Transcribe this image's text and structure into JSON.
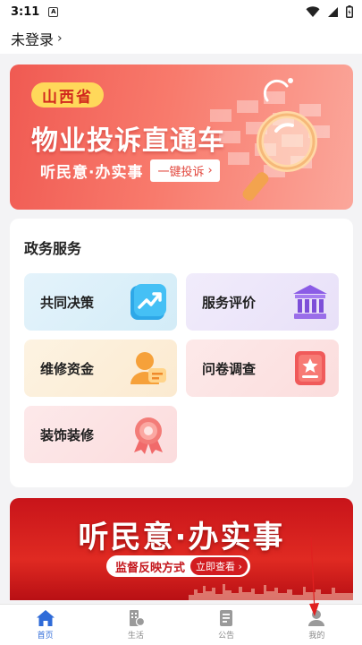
{
  "statusbar": {
    "time": "3:11",
    "notif_glyph": "A"
  },
  "header": {
    "login_text": "未登录",
    "chevron": "›"
  },
  "banner_complaint": {
    "province": "山西省",
    "title": "物业投诉直通车",
    "slogan": "听民意·办实事",
    "cta_label": "一键投诉",
    "cta_arrow": "›",
    "colors": {
      "start": "#f05a52",
      "end": "#fba79b",
      "badge": "#ffd85a"
    }
  },
  "gov_services": {
    "heading": "政务服务",
    "items": [
      {
        "label": "共同决策",
        "icon": "trend-chart-icon"
      },
      {
        "label": "服务评价",
        "icon": "bank-building-icon"
      },
      {
        "label": "维修资金",
        "icon": "person-money-icon"
      },
      {
        "label": "问卷调查",
        "icon": "survey-ribbon-icon"
      },
      {
        "label": "装饰装修",
        "icon": "award-medal-icon"
      }
    ]
  },
  "banner_supervision": {
    "title": "听民意·办实事",
    "pill_text": "监督反映方式",
    "button_label": "立即查看",
    "button_arrow": "›"
  },
  "tabbar": {
    "active_color": "#2f6bd8",
    "items": [
      {
        "label": "首页",
        "icon": "home-icon",
        "active": true
      },
      {
        "label": "生活",
        "icon": "building-icon",
        "active": false
      },
      {
        "label": "公告",
        "icon": "document-icon",
        "active": false
      },
      {
        "label": "我的",
        "icon": "user-icon",
        "active": false
      }
    ]
  }
}
